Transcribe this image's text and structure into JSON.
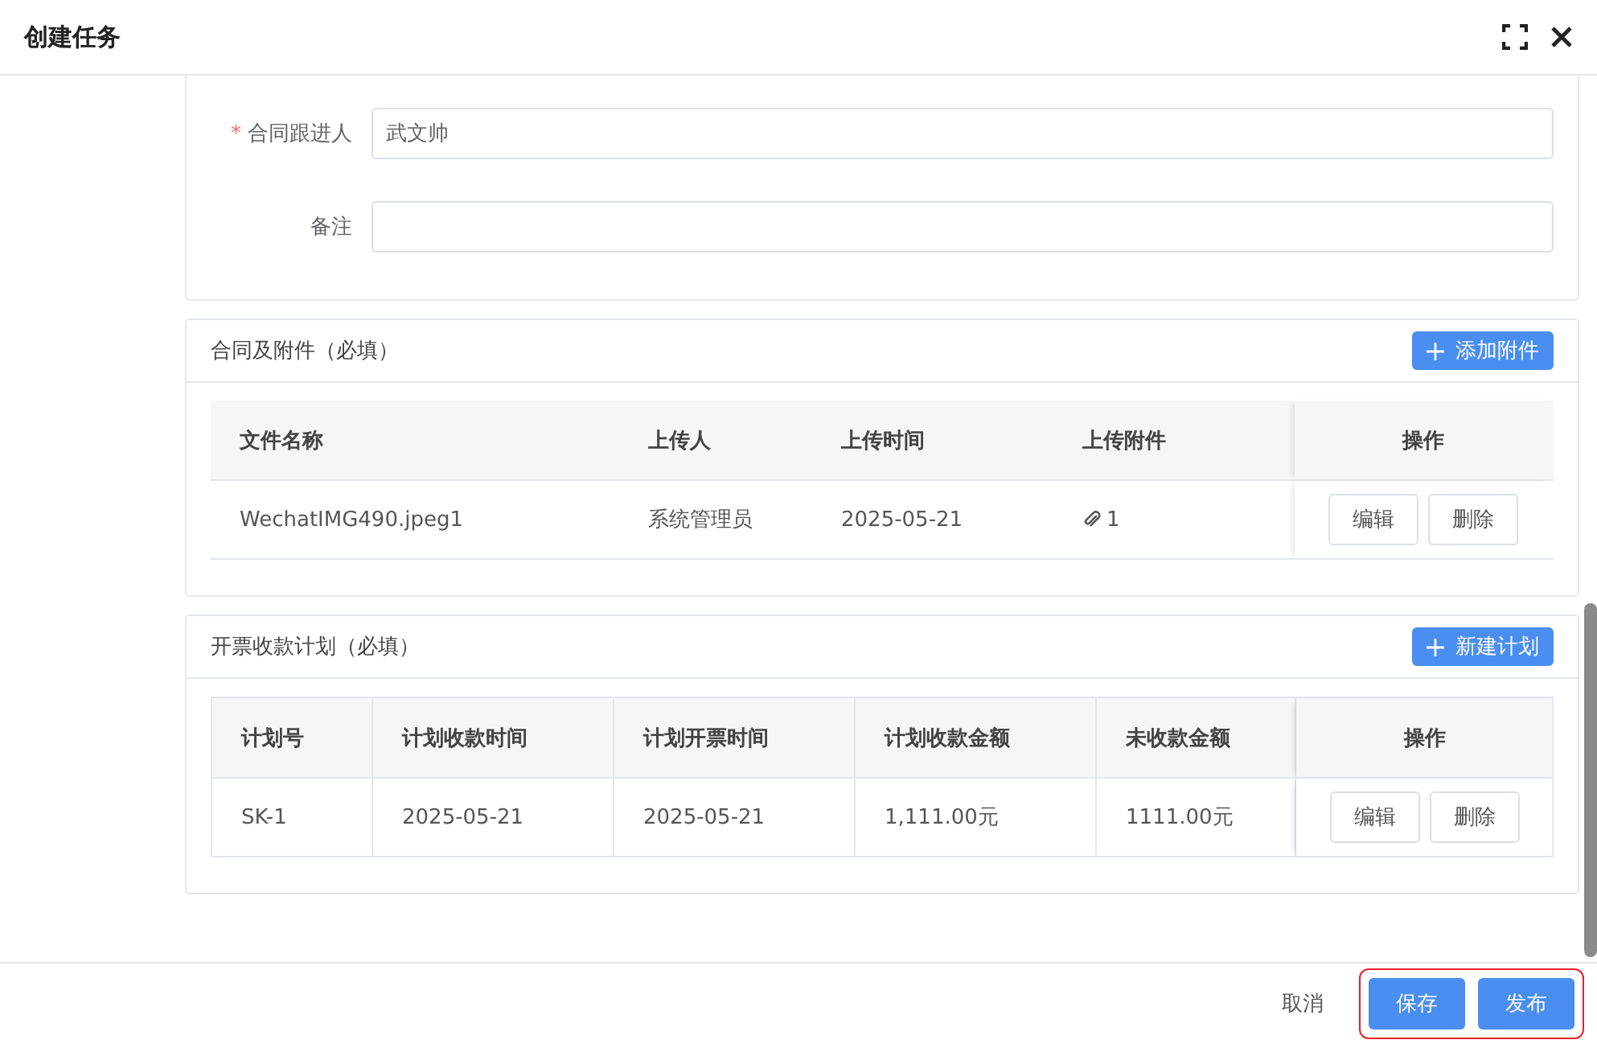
{
  "window": {
    "title": "创建任务"
  },
  "form": [
    {
      "label": "合同跟进人",
      "required_mark": "*",
      "value": "武文帅"
    },
    {
      "label": "备注"
    }
  ],
  "sections": [
    {
      "title": "合同及附件（必填）",
      "button": "添加附件",
      "bordered": false,
      "columns": [
        "文件名称",
        "上传人",
        "上传时间",
        "上传附件",
        "操作"
      ],
      "rows": [
        {
          "cells": [
            {
              "kind": "text",
              "text": "WechatIMG490.jpeg1"
            },
            {
              "kind": "text",
              "text": "系统管理员"
            },
            {
              "kind": "text",
              "text": "2025-05-21"
            },
            {
              "kind": "attachment",
              "text": "1"
            }
          ],
          "actions": [
            "编辑",
            "删除"
          ]
        }
      ]
    },
    {
      "title": "开票收款计划（必填）",
      "button": "新建计划",
      "bordered": true,
      "columns": [
        "计划号",
        "计划收款时间",
        "计划开票时间",
        "计划收款金额",
        "未收款金额",
        "操作"
      ],
      "rows": [
        {
          "cells": [
            {
              "kind": "text",
              "text": "SK-1"
            },
            {
              "kind": "text",
              "text": "2025-05-21"
            },
            {
              "kind": "text",
              "text": "2025-05-21"
            },
            {
              "kind": "text",
              "text": "1,111.00元"
            },
            {
              "kind": "text",
              "text": "1111.00元"
            }
          ],
          "actions": [
            "编辑",
            "删除"
          ]
        }
      ]
    }
  ],
  "footer": {
    "cancel": "取消",
    "highlighted_buttons": [
      "保存",
      "发布"
    ]
  }
}
